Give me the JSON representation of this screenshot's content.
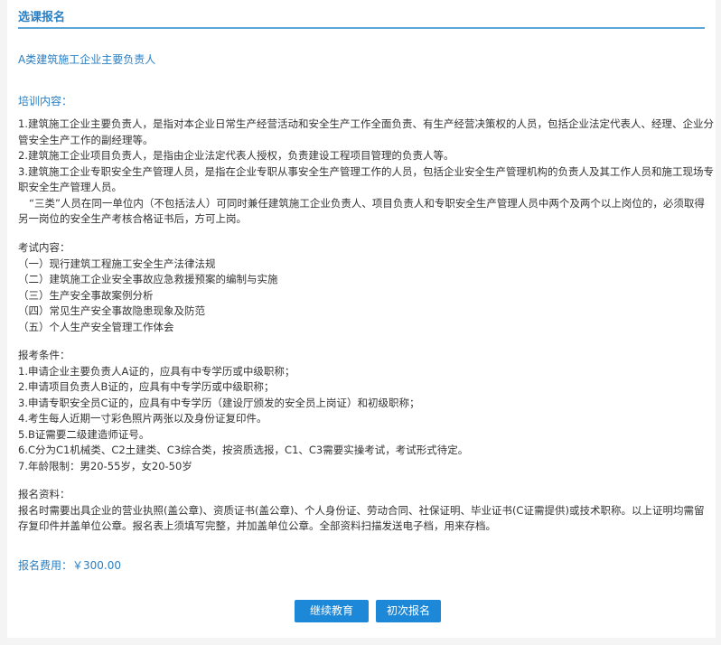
{
  "header": {
    "title": "选课报名"
  },
  "course": {
    "title": "A类建筑施工企业主要负责人"
  },
  "training": {
    "heading": "培训内容：",
    "items": [
      "1.建筑施工企业主要负责人，是指对本企业日常生产经营活动和安全生产工作全面负责、有生产经营决策权的人员，包括企业法定代表人、经理、企业分管安全生产工作的副经理等。",
      "2.建筑施工企业项目负责人，是指由企业法定代表人授权，负责建设工程项目管理的负责人等。",
      "3.建筑施工企业专职安全生产管理人员，是指在企业专职从事安全生产管理工作的人员，包括企业安全生产管理机构的负责人及其工作人员和施工现场专职安全生产管理人员。",
      "“三类”人员在同一单位内（不包括法人）可同时兼任建筑施工企业负责人、项目负责人和专职安全生产管理人员中两个及两个以上岗位的，必须取得另一岗位的安全生产考核合格证书后，方可上岗。"
    ]
  },
  "exam": {
    "heading": "考试内容：",
    "items": [
      "（一）现行建筑工程施工安全生产法律法规",
      "（二）建筑施工企业安全事故应急救援预案的编制与实施",
      "（三）生产安全事故案例分析",
      "（四）常见生产安全事故隐患现象及防范",
      "（五）个人生产安全管理工作体会"
    ]
  },
  "conditions": {
    "heading": "报考条件：",
    "items": [
      "1.申请企业主要负责人A证的，应具有中专学历或中级职称；",
      "2.申请项目负责人B证的，应具有中专学历或中级职称；",
      "3.申请专职安全员C证的，应具有中专学历（建设厅颁发的安全员上岗证）和初级职称；",
      "4.考生每人近期一寸彩色照片两张以及身份证复印件。",
      "5.B证需要二级建造师证号。",
      "6.C分为C1机械类、C2土建类、C3综合类，按资质选报，C1、C3需要实操考试，考试形式待定。",
      "7.年龄限制：男20-55岁，女20-50岁"
    ]
  },
  "materials": {
    "heading": "报名资料：",
    "text": "报名时需要出具企业的营业执照(盖公章)、资质证书(盖公章)、个人身份证、劳动合同、社保证明、毕业证书(C证需提供)或技术职称。以上证明均需留存复印件并盖单位公章。报名表上须填写完整，并加盖单位公章。全部资料扫描发送电子档，用来存档。"
  },
  "fee": {
    "text": "报名费用：￥300.00"
  },
  "buttons": {
    "continue_label": "继续教育",
    "first_label": "初次报名"
  },
  "colors": {
    "accent": "#2a7fc3",
    "button": "#1e88d8",
    "divider": "#5aa6d6"
  }
}
